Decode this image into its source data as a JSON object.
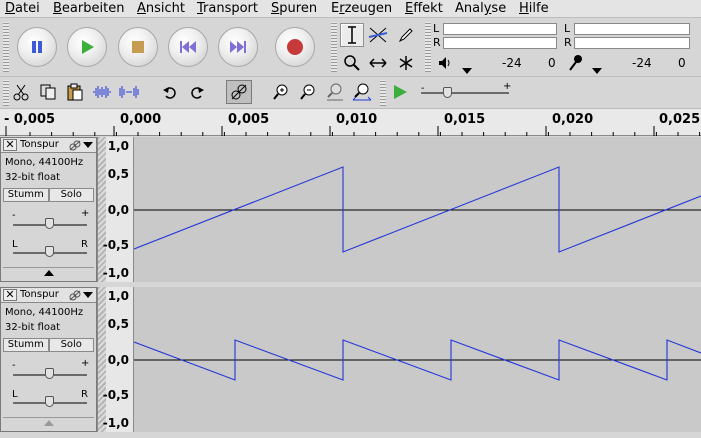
{
  "menubar": {
    "items": [
      {
        "pre": "",
        "u": "D",
        "post": "atei"
      },
      {
        "pre": "",
        "u": "B",
        "post": "earbeiten"
      },
      {
        "pre": "",
        "u": "A",
        "post": "nsicht"
      },
      {
        "pre": "",
        "u": "T",
        "post": "ransport"
      },
      {
        "pre": "",
        "u": "S",
        "post": "puren"
      },
      {
        "pre": "E",
        "u": "r",
        "post": "zeugen"
      },
      {
        "pre": "",
        "u": "E",
        "post": "ffekt"
      },
      {
        "pre": "Anal",
        "u": "y",
        "post": "se"
      },
      {
        "pre": "",
        "u": "H",
        "post": "ilfe"
      }
    ]
  },
  "meters": {
    "playback_left": "L",
    "playback_right": "R",
    "record_left": "L",
    "record_right": "R",
    "playback_db": "-24",
    "playback_zero": "0",
    "record_db": "-24",
    "record_zero": "0"
  },
  "ruler": {
    "labels": [
      "- 0,005",
      "0,000",
      "0,005",
      "0,010",
      "0,015",
      "0,020",
      "0,025"
    ]
  },
  "vruler": {
    "labels": [
      "1,0",
      "0,5",
      "0,0",
      "-0,5",
      "-1,0"
    ]
  },
  "tracks": [
    {
      "name": "Tonspur",
      "info_rate": "Mono, 44100Hz",
      "info_format": "32-bit float",
      "mute": "Stumm",
      "solo": "Solo",
      "gain_minus": "-",
      "gain_plus": "+",
      "pan_left": "L",
      "pan_right": "R",
      "gain": 0.5,
      "pan": 0.5
    },
    {
      "name": "Tonspur",
      "info_rate": "Mono, 44100Hz",
      "info_format": "32-bit float",
      "mute": "Stumm",
      "solo": "Solo",
      "gain_minus": "-",
      "gain_plus": "+",
      "pan_left": "L",
      "pan_right": "R",
      "gain": 0.5,
      "pan": 0.5
    }
  ],
  "colors": {
    "waveform": "#2436d8",
    "play": "#3cae3c",
    "record": "#c63a3a",
    "pause": "#3b5bd9",
    "skip": "#7f6fd6"
  }
}
